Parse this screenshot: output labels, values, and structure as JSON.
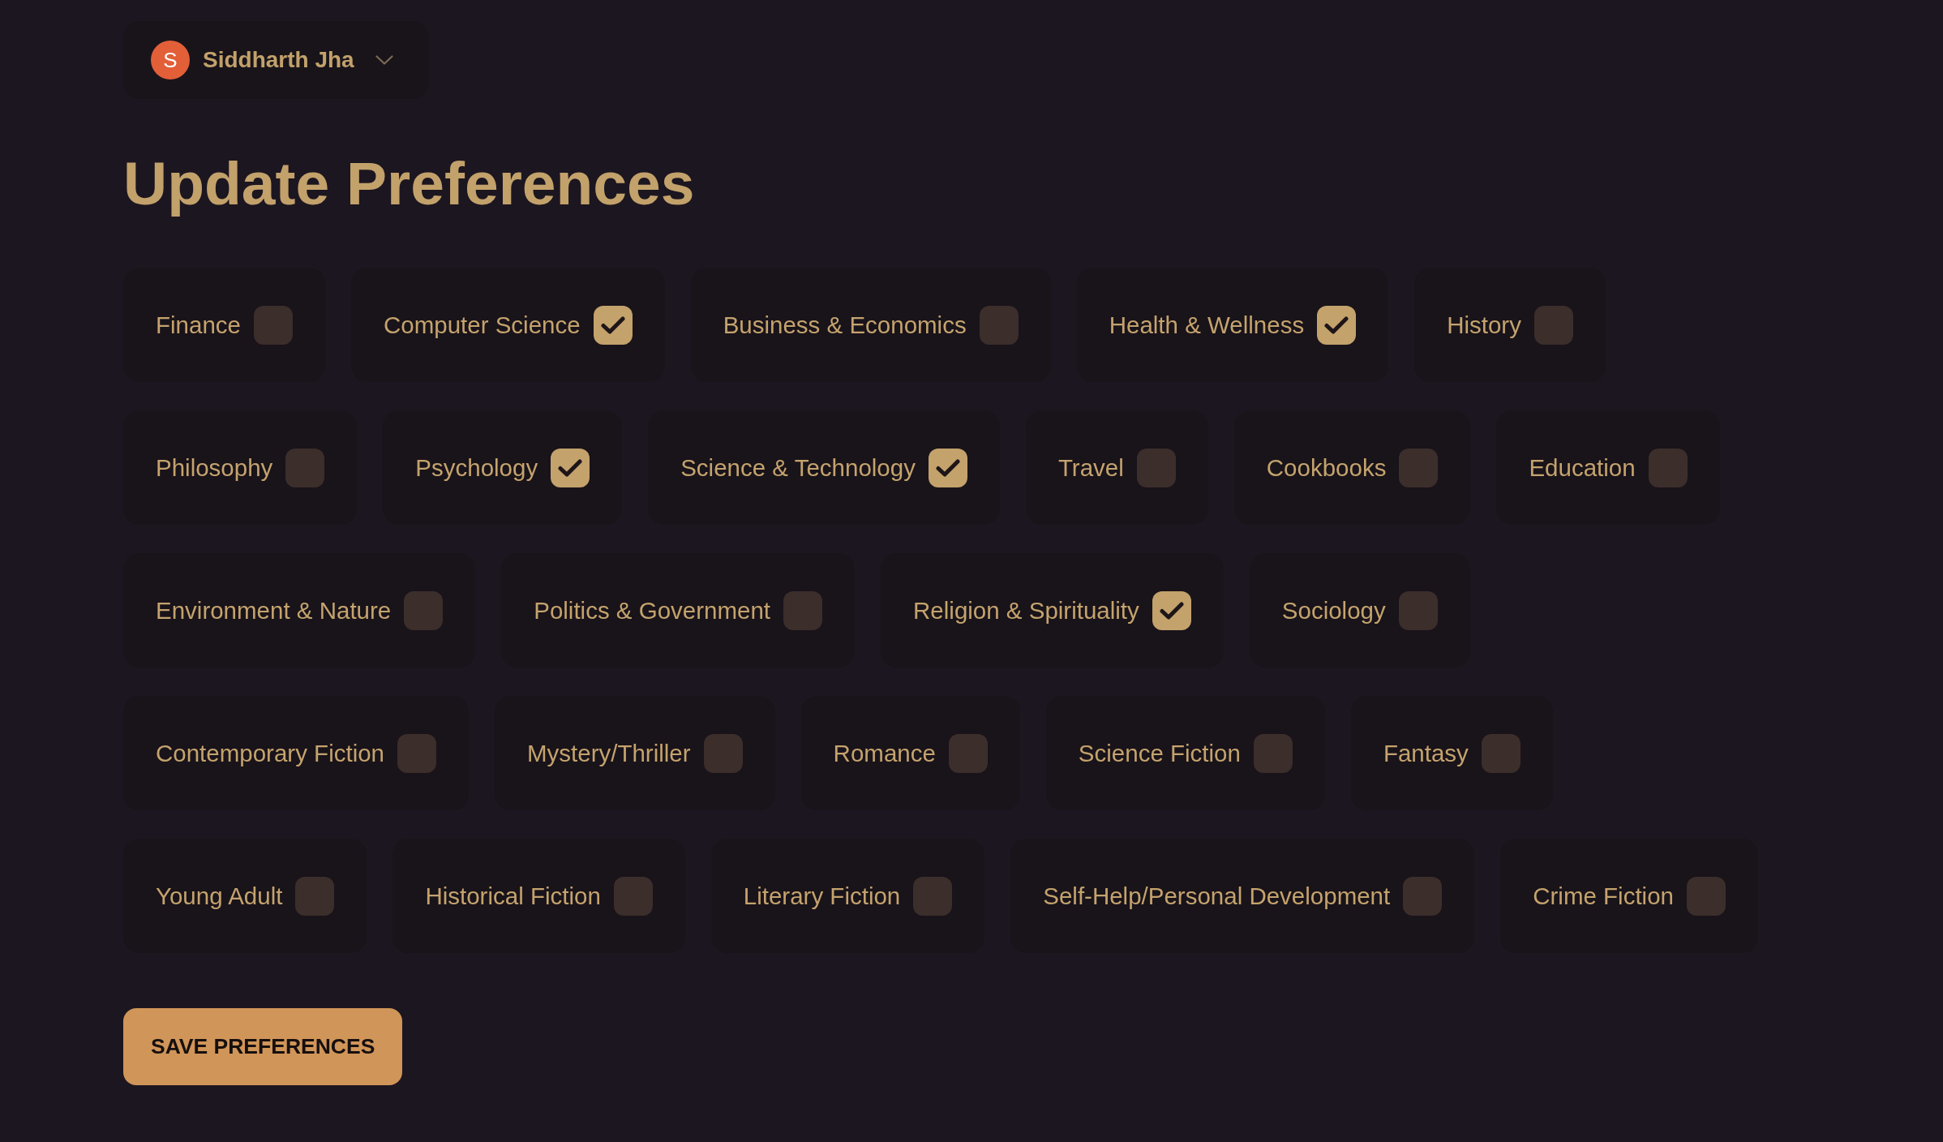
{
  "user_menu": {
    "avatar_letter": "S",
    "name": "Siddharth Jha"
  },
  "title": "Update Preferences",
  "preferences": [
    {
      "label": "Finance",
      "checked": false
    },
    {
      "label": "Computer Science",
      "checked": true
    },
    {
      "label": "Business & Economics",
      "checked": false
    },
    {
      "label": "Health & Wellness",
      "checked": true
    },
    {
      "label": "History",
      "checked": false
    },
    {
      "label": "Philosophy",
      "checked": false
    },
    {
      "label": "Psychology",
      "checked": true
    },
    {
      "label": "Science & Technology",
      "checked": true
    },
    {
      "label": "Travel",
      "checked": false
    },
    {
      "label": "Cookbooks",
      "checked": false
    },
    {
      "label": "Education",
      "checked": false
    },
    {
      "label": "Environment & Nature",
      "checked": false
    },
    {
      "label": "Politics & Government",
      "checked": false
    },
    {
      "label": "Religion & Spirituality",
      "checked": true
    },
    {
      "label": "Sociology",
      "checked": false
    },
    {
      "label": "Contemporary Fiction",
      "checked": false
    },
    {
      "label": "Mystery/Thriller",
      "checked": false
    },
    {
      "label": "Romance",
      "checked": false
    },
    {
      "label": "Science Fiction",
      "checked": false
    },
    {
      "label": "Fantasy",
      "checked": false
    },
    {
      "label": "Young Adult",
      "checked": false
    },
    {
      "label": "Historical Fiction",
      "checked": false
    },
    {
      "label": "Literary Fiction",
      "checked": false
    },
    {
      "label": "Self-Help/Personal Development",
      "checked": false
    },
    {
      "label": "Crime Fiction",
      "checked": false
    }
  ],
  "save_button": "SAVE PREFERENCES"
}
